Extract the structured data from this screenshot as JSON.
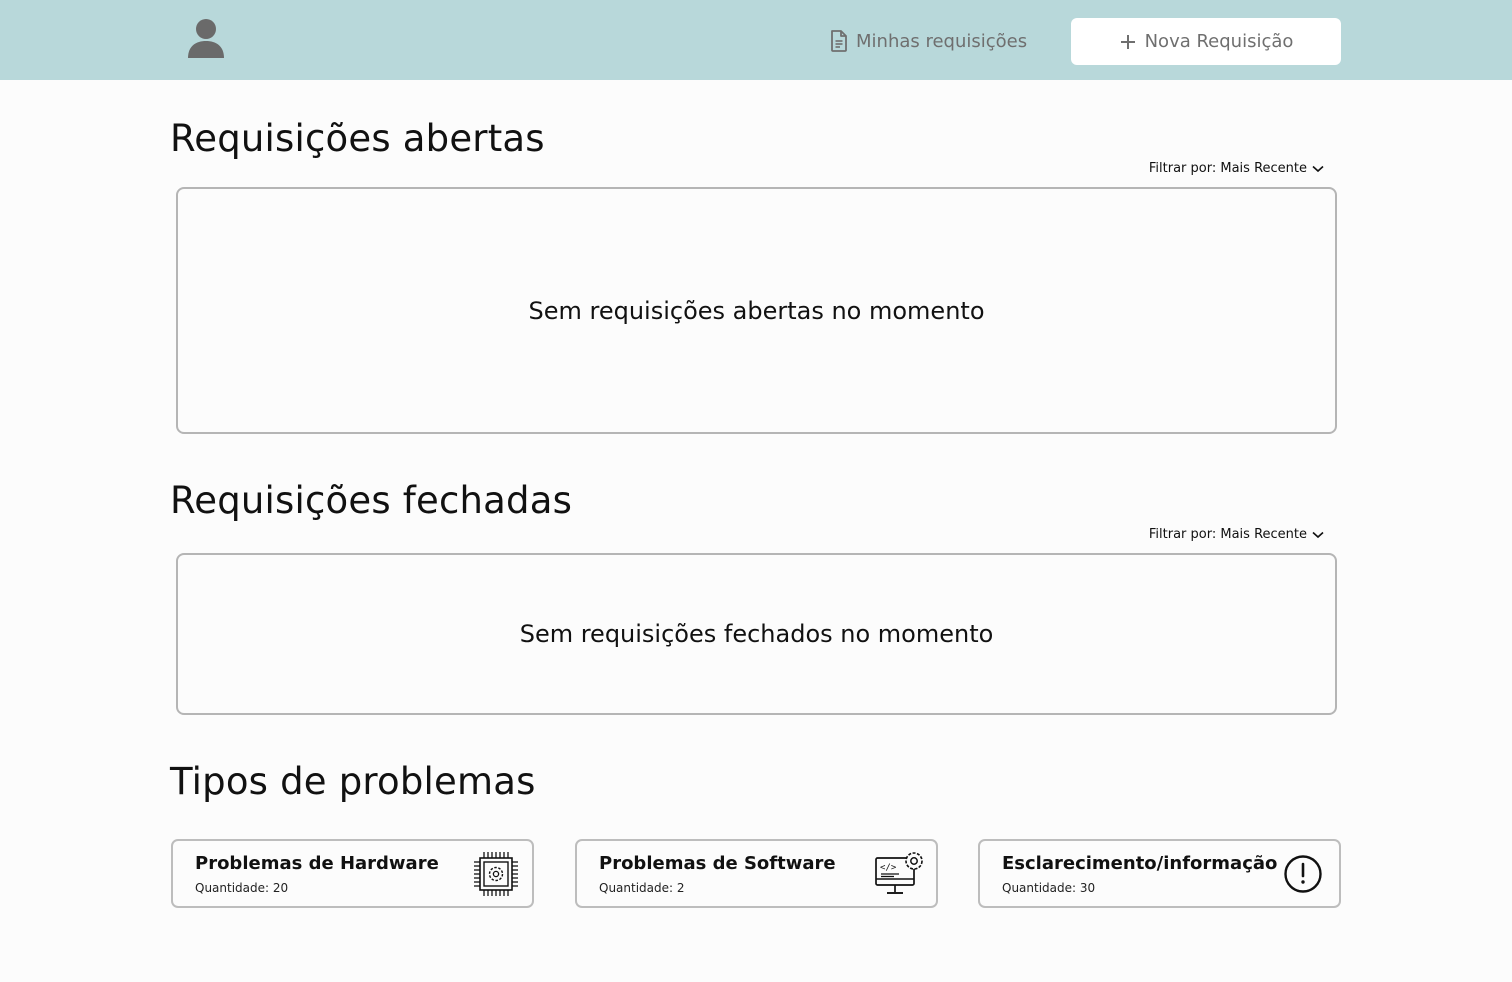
{
  "header": {
    "avatar_icon": "user-icon",
    "my_requests": {
      "label": "Minhas requisições",
      "icon": "document-icon"
    },
    "new_request": {
      "label": "Nova Requisição",
      "icon": "plus-icon"
    }
  },
  "open_requests": {
    "title": "Requisições abertas",
    "filter_label": "Filtrar por: Mais Recente",
    "empty_message": "Sem requisições abertas no momento"
  },
  "closed_requests": {
    "title": "Requisições fechadas",
    "filter_label": "Filtrar por: Mais Recente",
    "empty_message": "Sem requisições fechados no momento"
  },
  "problem_types": {
    "title": "Tipos de problemas",
    "cards": [
      {
        "title": "Problemas de Hardware",
        "quantity": "Quantidade: 20",
        "icon": "chip-gear-icon"
      },
      {
        "title": "Problemas de Software",
        "quantity": "Quantidade: 2",
        "icon": "computer-code-gear-icon"
      },
      {
        "title": "Esclarecimento/informação",
        "quantity": "Quantidade: 30",
        "icon": "exclamation-circle-icon"
      }
    ]
  },
  "colors": {
    "header_bg": "#b8d8da",
    "page_bg": "#fcfcfc",
    "muted_text": "#6f6f6f",
    "border": "#b5b5b5"
  }
}
